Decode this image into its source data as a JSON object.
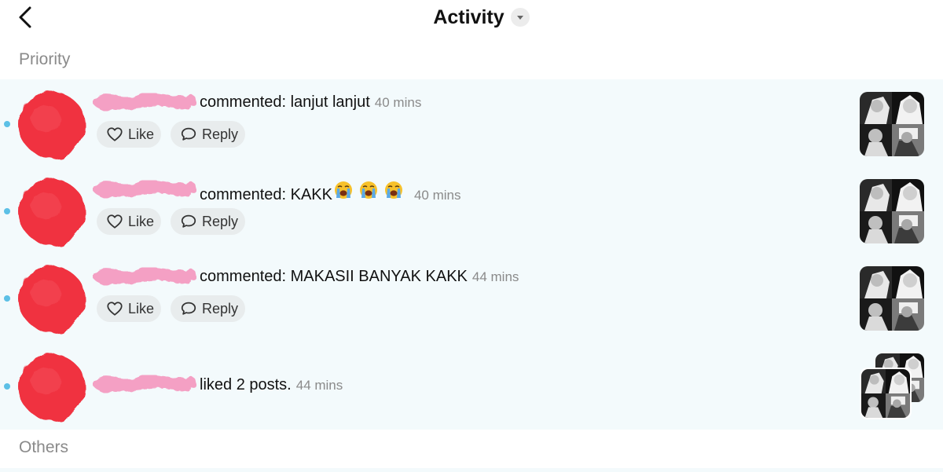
{
  "header": {
    "title": "Activity",
    "back_icon": "chevron-left-icon",
    "dropdown_icon": "caret-down-icon"
  },
  "sections": {
    "priority_label": "Priority",
    "others_label": "Others"
  },
  "actions": {
    "like_label": "Like",
    "reply_label": "Reply"
  },
  "notifications": [
    {
      "text": "commented: lanjut lanjut",
      "time": "40 mins"
    },
    {
      "text": "commented: KAKK",
      "emojis": [
        "loudly-crying-face",
        "loudly-crying-face",
        "loudly-crying-face"
      ],
      "time": "40 mins"
    },
    {
      "text": "commented: MAKASII BANYAK KAKK",
      "time": "44 mins"
    },
    {
      "text": "liked 2 posts.",
      "time": "44 mins"
    }
  ],
  "colors": {
    "unread_dot": "#5cc0e6",
    "priority_bg": "#f3fafc",
    "pill_bg": "#e8eced",
    "avatar_redact": "#f0303f",
    "name_redact": "#f4a0c4",
    "muted_text": "#8a8a8a"
  }
}
